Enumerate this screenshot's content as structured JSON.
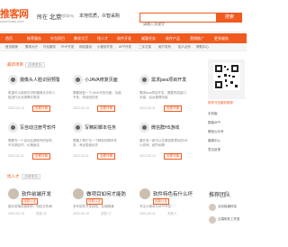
{
  "header": {
    "logo_main": "推客网",
    "logo_sub": "www.tuike.com",
    "city": "北京",
    "city_prefix": "所在",
    "city_switch": "[切换城市]",
    "slogan": "本地优质，众智采购",
    "search_placeholder": "请输入关键字",
    "search_button": "搜索",
    "colors": {
      "accent": "#f05a1e"
    }
  },
  "nav": [
    "首页",
    "推荐服务",
    "外包项目",
    "需求大厅",
    "找人才",
    "软件开发",
    "威客任务",
    "软件产品",
    "营销推广",
    "更多服务"
  ],
  "subnav": [
    "首页推荐",
    "需求大厅",
    "外包服务",
    "PHP开发",
    "网站建设",
    "小程序开发",
    "APP开发",
    "二手交易",
    "用户发布",
    "招人合作",
    "帮助中心"
  ],
  "recommend": {
    "title": "最新项目",
    "more": "[查看更多]",
    "cards": [
      {
        "title": "摄像头人脸识别预警",
        "desc": "希望可以用软件识别摄像头中的人脸进行比对报警并推送",
        "date": "2022-02-10",
        "tag": "查看详情",
        "icon": "document-icon"
      },
      {
        "title": "小JAVA修复页面",
        "desc": "需要修复一个JAVA写的页面，功能不多，有经验的来",
        "date": "2022-02-10",
        "tag": "查看详情",
        "icon": "document-icon"
      },
      {
        "title": "需求java项目开发",
        "desc": "需求java项目开发，需要完成接口对接，后台管理功能",
        "date": "2022-02-11",
        "tag": "查看详情",
        "icon": "document-icon"
      },
      {
        "title": "写自动注册号软件",
        "desc": "需要写一个自动注册账号的软件，可长期合作，价格面议",
        "date": "2022-02-11",
        "tag": "查看详情",
        "icon": "document-icon"
      },
      {
        "title": "写精彩脚本任务",
        "desc": "需要人帮忙写一个精彩的脚本任务，有经验者优先",
        "date": "2022-02-11",
        "tag": "查看详情",
        "icon": "document-icon"
      },
      {
        "title": "微信群H5游戏",
        "desc": "要开发一款可以在微信群里玩的H5小游戏，细节私聊",
        "date": "2022-02-12",
        "tag": "查看详情",
        "icon": "document-icon"
      }
    ]
  },
  "talent": {
    "title": "找人才",
    "more": "[查看更多]",
    "people": [
      {
        "name": "软件前端开发",
        "tag": "技能认证",
        "desc": "擅长前端页面制作，响应式布局",
        "date": "2022-02-10",
        "views": "浏览 21"
      },
      {
        "name": "做项目如何才能防",
        "tag": "技能认证",
        "desc": "多年软件开发经验，后端精通",
        "date": "2022-02-10",
        "views": "浏览 17"
      },
      {
        "name": "软件特色有什么坏",
        "tag": "技能认证",
        "desc": "专注小程序与APP开发",
        "date": "2022-02-11",
        "views": "浏览 9"
      }
    ]
  },
  "sidebar": {
    "qr_label": "软件外包服务推荐",
    "links": [
      "手机版",
      "推客APP",
      "微信公众号",
      "客服中心",
      "意见反馈"
    ],
    "recommend_title": "推荐团队",
    "teams": [
      "北京极速科技",
      "云端软件工作室"
    ]
  }
}
